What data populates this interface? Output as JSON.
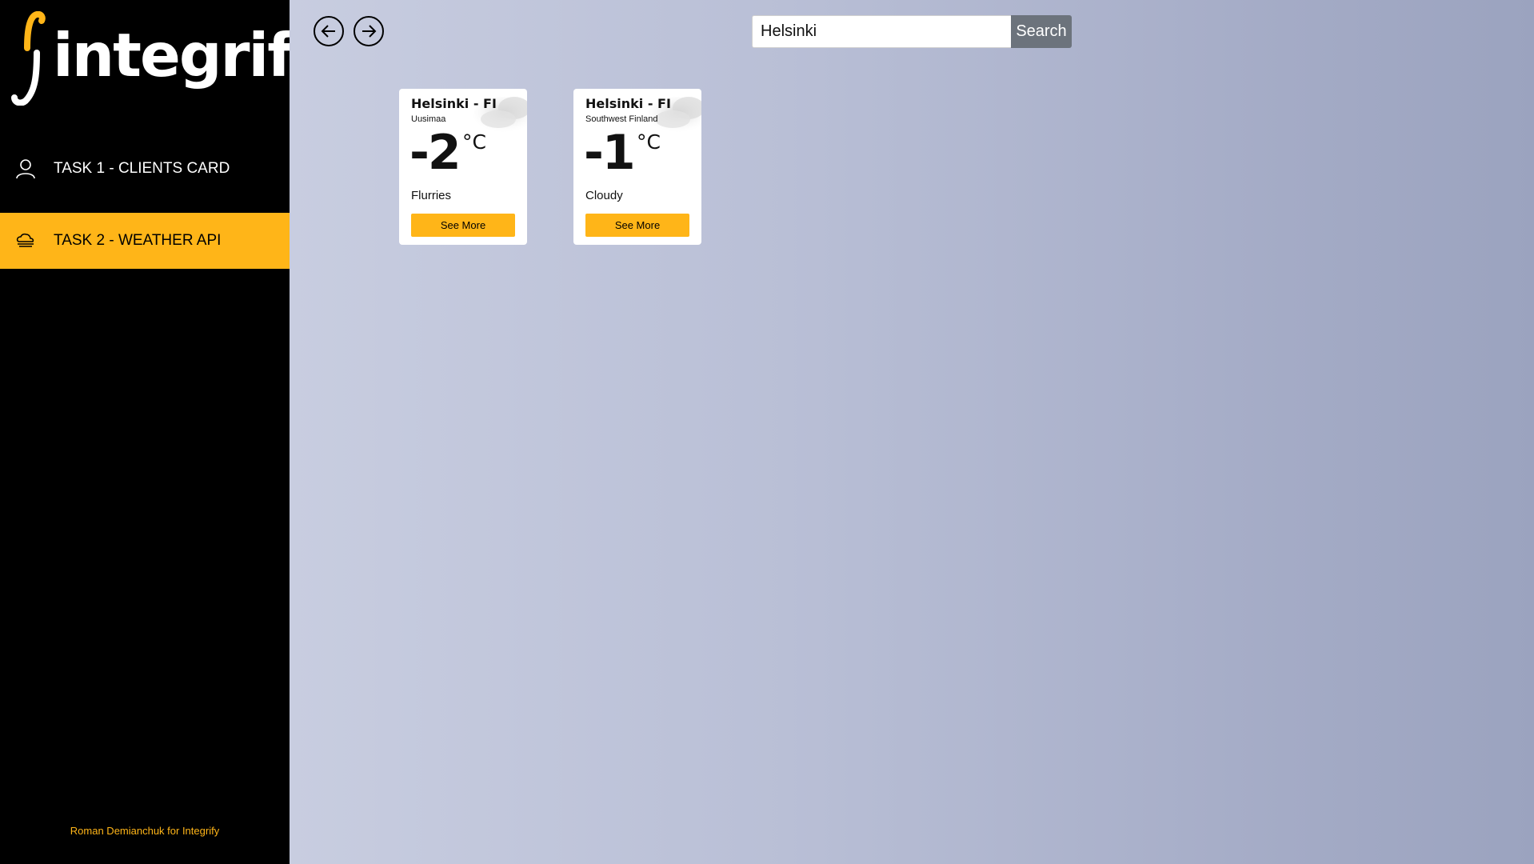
{
  "brand": {
    "name": "integrify",
    "accent_color": "#ffb518"
  },
  "sidebar": {
    "items": [
      {
        "label": "TASK 1 - CLIENTS CARD",
        "icon": "user-icon",
        "active": false
      },
      {
        "label": "TASK 2 - WEATHER API",
        "icon": "cloud-icon",
        "active": true
      }
    ],
    "footer": "Roman Demianchuk for Integrify"
  },
  "nav": {
    "back_icon": "arrow-left-icon",
    "forward_icon": "arrow-right-icon"
  },
  "search": {
    "value": "Helsinki",
    "button_label": "Search"
  },
  "cards": [
    {
      "city": "Helsinki - FI",
      "region": "Uusimaa",
      "temp": "-2",
      "unit": "°C",
      "condition": "Flurries",
      "button_label": "See More"
    },
    {
      "city": "Helsinki - FI",
      "region": "Southwest Finland",
      "temp": "-1",
      "unit": "°C",
      "condition": "Cloudy",
      "button_label": "See More"
    }
  ]
}
